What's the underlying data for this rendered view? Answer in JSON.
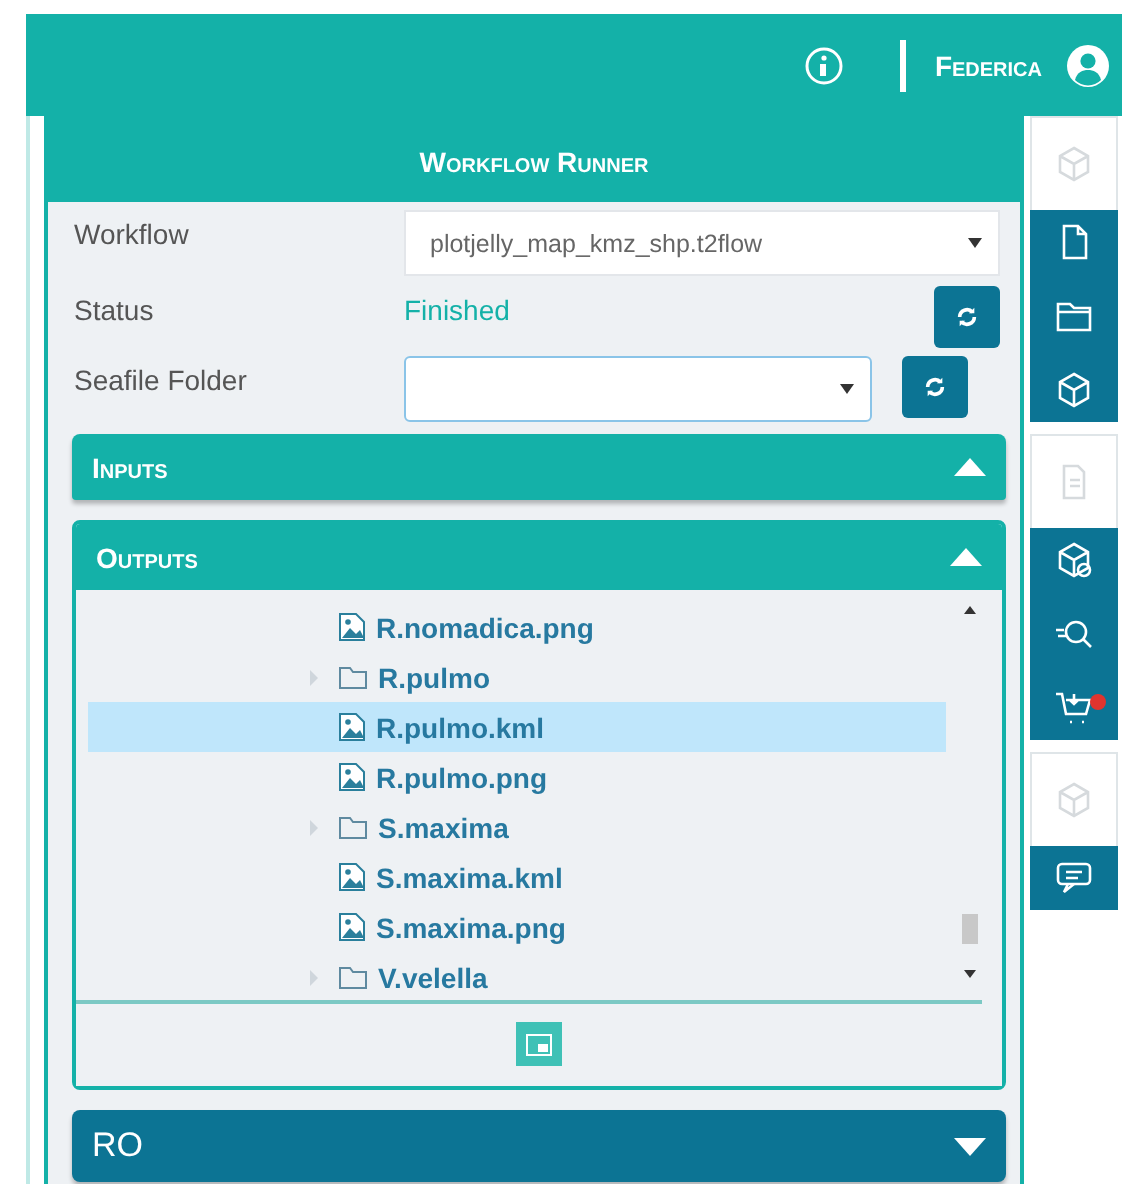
{
  "header": {
    "username": "Federica"
  },
  "panel": {
    "title": "Workflow Runner",
    "fields": [
      {
        "label": "Workflow",
        "kind": "select",
        "value": "plotjelly_map_kmz_shp.t2flow",
        "refresh": false
      },
      {
        "label": "Status",
        "kind": "status",
        "value": "Finished",
        "refresh": true
      },
      {
        "label": "Seafile Folder",
        "kind": "select",
        "refresh": true
      }
    ],
    "sections": [
      {
        "title": "Inputs",
        "kind": "panel",
        "expanded": false
      },
      {
        "title": "Outputs",
        "kind": "panel",
        "expanded": true,
        "tree": [
          {
            "name": "R.nomadica.png",
            "kind": "file",
            "selected": false
          },
          {
            "name": "R.pulmo",
            "kind": "folder",
            "selected": false
          },
          {
            "name": "R.pulmo.kml",
            "kind": "file",
            "selected": true
          },
          {
            "name": "R.pulmo.png",
            "kind": "file",
            "selected": false
          },
          {
            "name": "S.maxima",
            "kind": "folder",
            "selected": false
          },
          {
            "name": "S.maxima.kml",
            "kind": "file",
            "selected": false
          },
          {
            "name": "S.maxima.png",
            "kind": "file",
            "selected": false
          },
          {
            "name": "V.velella",
            "kind": "folder",
            "selected": false
          }
        ]
      },
      {
        "title": "RO",
        "kind": "bar",
        "expanded": false
      }
    ]
  }
}
